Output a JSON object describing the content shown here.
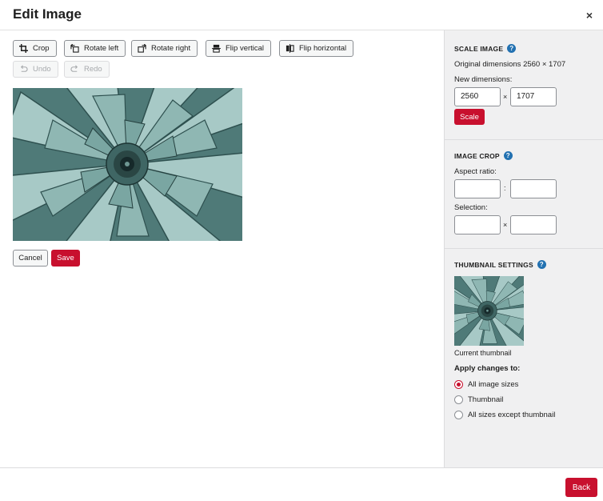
{
  "header": {
    "title": "Edit Image",
    "close_glyph": "×"
  },
  "toolbar": {
    "crop": "Crop",
    "rotate_left": "Rotate left",
    "rotate_right": "Rotate right",
    "flip_vertical": "Flip vertical",
    "flip_horizontal": "Flip horizontal",
    "undo": "Undo",
    "redo": "Redo"
  },
  "editor": {
    "cancel": "Cancel",
    "save": "Save"
  },
  "scale": {
    "title": "Scale Image",
    "original": "Original dimensions 2560 × 1707",
    "new_label": "New dimensions:",
    "width": "2560",
    "height": "1707",
    "sep": "×",
    "button": "Scale"
  },
  "crop": {
    "title": "Image Crop",
    "aspect_label": "Aspect ratio:",
    "aspect_sep": ":",
    "selection_label": "Selection:",
    "selection_sep": "×"
  },
  "thumbnail": {
    "title": "Thumbnail Settings",
    "caption": "Current thumbnail",
    "apply_label": "Apply changes to:",
    "options": [
      {
        "label": "All image sizes",
        "checked": true
      },
      {
        "label": "Thumbnail",
        "checked": false
      },
      {
        "label": "All sizes except thumbnail",
        "checked": false
      }
    ]
  },
  "footer": {
    "back": "Back"
  },
  "colors": {
    "accent": "#c8102e",
    "help": "#2271b1",
    "sidebar_bg": "#f0f0f1"
  }
}
